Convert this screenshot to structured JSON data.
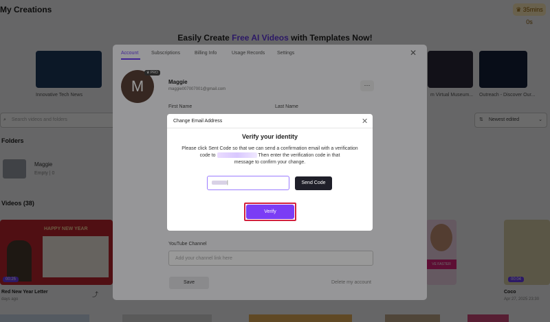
{
  "page": {
    "title": "My Creations",
    "minutes_badge": "35mins 0s",
    "hero_prefix": "Easily Create ",
    "hero_accent": "Free AI Videos",
    "hero_suffix": " with Templates Now!",
    "template_captions": [
      "Innovative Tech News",
      "m Virtual Museum...",
      "Outreach - Discover Our..."
    ],
    "search_placeholder": "Search videos and folders",
    "sort_label": "Newest edited",
    "folders_heading": "Folders",
    "folder": {
      "name": "Maggie",
      "meta": "Empty  |  0"
    },
    "videos_heading": "Videos (38)",
    "videos": [
      {
        "title": "Red New Year Letter",
        "sub": "days ago",
        "duration": "00:25"
      },
      {
        "title": "Coco",
        "sub": "Apr 27, 2025 23:30",
        "duration": "00:04"
      }
    ],
    "card_banner": "HAPPY NEW YEAR",
    "card2_banner": "VE FASTER"
  },
  "account_panel": {
    "tabs": [
      "Account",
      "Subscriptions",
      "Billing Info",
      "Usage Records",
      "Settings"
    ],
    "avatar_letter": "M",
    "pro_badge": "PRO",
    "user_name": "Maggie",
    "user_email": "maggie007007001@gmail.com",
    "more_label": "···",
    "first_name_label": "First Name",
    "last_name_label": "Last Name",
    "youtube_label": "YouTube Channel",
    "youtube_placeholder": "Add your channel link here",
    "save_label": "Save",
    "delete_label": "Delete my account"
  },
  "dialog": {
    "title": "Change Email Address",
    "heading": "Verify your identity",
    "desc_line1": "Please click Sent Code so that we can send a confirmation email with a verification",
    "desc_line2_prefix": "code to",
    "desc_line2_suffix": "Then enter the verification code in that",
    "desc_line3": "message to confirm your change.",
    "send_code_label": "Send Code",
    "verify_label": "Verify"
  },
  "colors": {
    "accent": "#6b3df5",
    "highlight_border": "#d21f3c",
    "dark_button": "#1f1f29"
  }
}
